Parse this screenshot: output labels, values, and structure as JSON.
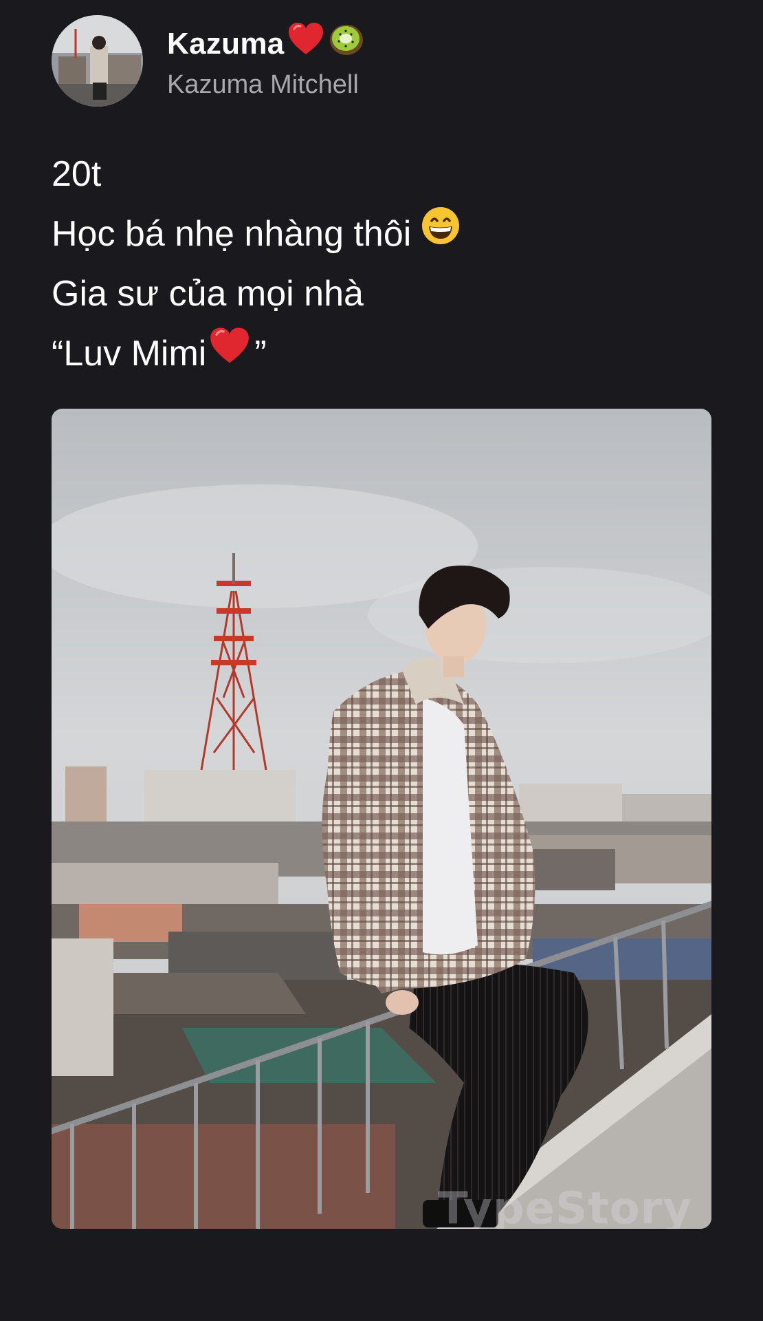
{
  "profile": {
    "display_name": "Kazuma",
    "display_name_emojis": [
      "red-heart-emoji",
      "kiwi-emoji"
    ],
    "handle": "Kazuma Mitchell"
  },
  "bio": {
    "line1": "20t",
    "line2": "Học bá nhẹ nhàng thôi",
    "line2_emoji": "grinning-face-emoji",
    "line3": "Gia sư của mọi nhà",
    "line4_open": "“Luv Mimi",
    "line4_emoji": "red-heart-emoji",
    "line4_close": "”"
  },
  "photo": {
    "description_icon": "rooftop-portrait-photo",
    "watermark": "TypeStory"
  },
  "colors": {
    "background": "#1a1a1e",
    "text_primary": "#ffffff",
    "text_secondary": "#a8a8ad",
    "heart": "#e0262e"
  }
}
